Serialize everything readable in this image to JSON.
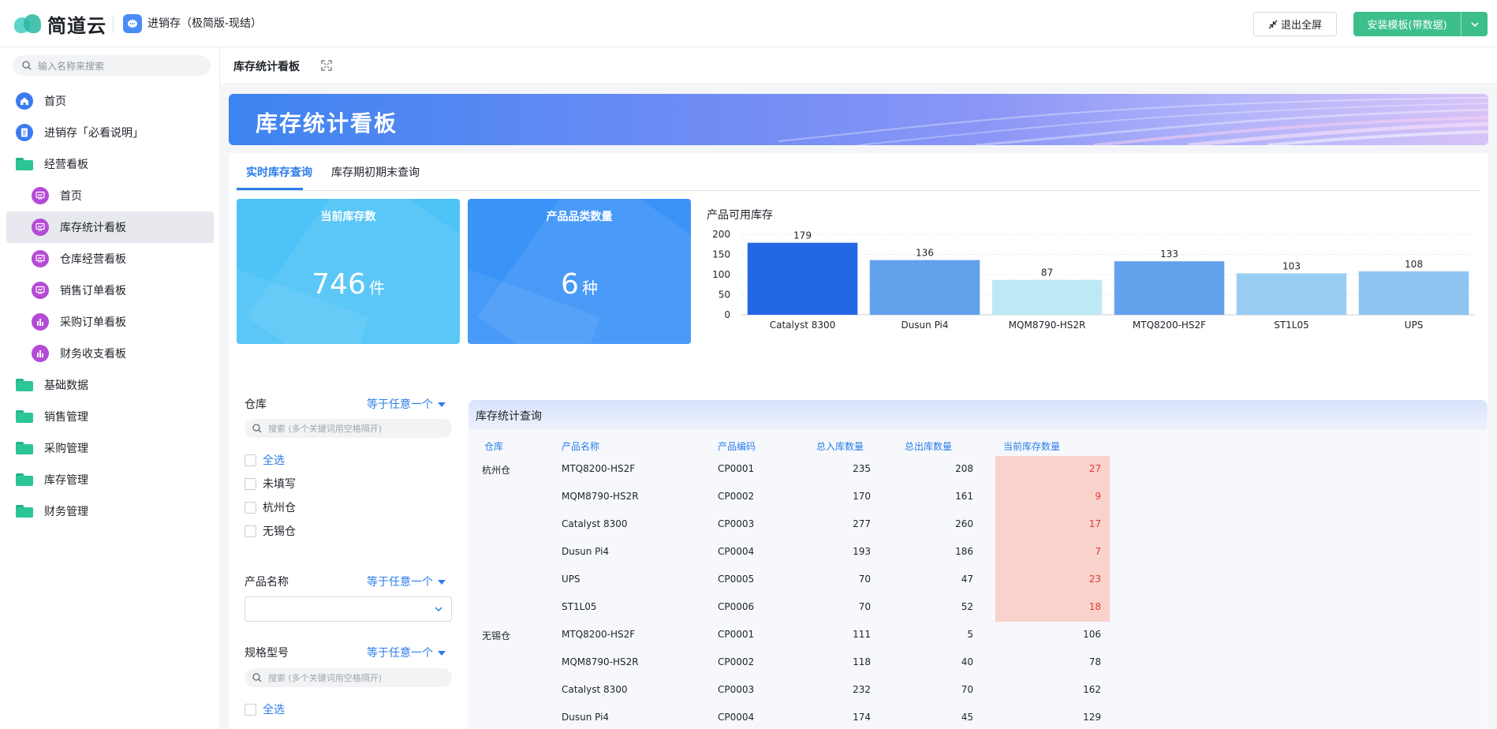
{
  "header": {
    "logo_text": "简道云",
    "app_name": "进销存（极简版-现结）",
    "exit_fullscreen": "退出全屏",
    "install_template": "安装模板(带数据)"
  },
  "sidebar": {
    "search_placeholder": "输入名称来搜索",
    "items": [
      {
        "label": "首页",
        "level": 0,
        "icon": "home-icon"
      },
      {
        "label": "进销存「必看说明」",
        "level": 0,
        "icon": "document-icon"
      },
      {
        "label": "经营看板",
        "level": 0,
        "icon": "folder-open-icon"
      },
      {
        "label": "首页",
        "level": 1,
        "icon": "dashboard-icon"
      },
      {
        "label": "库存统计看板",
        "level": 1,
        "icon": "dashboard-icon",
        "active": true
      },
      {
        "label": "仓库经营看板",
        "level": 1,
        "icon": "dashboard-icon"
      },
      {
        "label": "销售订单看板",
        "level": 1,
        "icon": "dashboard-icon"
      },
      {
        "label": "采购订单看板",
        "level": 1,
        "icon": "bar-chart-icon"
      },
      {
        "label": "财务收支看板",
        "level": 1,
        "icon": "bar-chart-icon"
      },
      {
        "label": "基础数据",
        "level": 0,
        "icon": "folder-icon"
      },
      {
        "label": "销售管理",
        "level": 0,
        "icon": "folder-icon"
      },
      {
        "label": "采购管理",
        "level": 0,
        "icon": "folder-icon"
      },
      {
        "label": "库存管理",
        "level": 0,
        "icon": "folder-icon"
      },
      {
        "label": "财务管理",
        "level": 0,
        "icon": "folder-icon"
      }
    ]
  },
  "page": {
    "title": "库存统计看板",
    "banner_title": "库存统计看板",
    "tabs": [
      "实时库存查询",
      "库存期初期末查询"
    ]
  },
  "cards": [
    {
      "title": "当前库存数",
      "value": "746",
      "unit": "件",
      "color": "#4ec3f7"
    },
    {
      "title": "产品品类数量",
      "value": "6",
      "unit": "种",
      "color": "#3b93f8"
    }
  ],
  "chart_data": {
    "type": "bar",
    "title": "产品可用库存",
    "categories": [
      "Catalyst 8300",
      "Dusun Pi4",
      "MQM8790-HS2R",
      "MTQ8200-HS2F",
      "ST1L05",
      "UPS"
    ],
    "values": [
      179,
      136,
      87,
      133,
      103,
      108
    ],
    "colors": [
      "#2467e4",
      "#62a1ec",
      "#bde9f6",
      "#62a1ec",
      "#99cdf4",
      "#8ec4f2"
    ],
    "ylim": [
      0,
      200
    ],
    "yticks": [
      0,
      50,
      100,
      150,
      200
    ]
  },
  "filters": {
    "warehouse": {
      "label": "仓库",
      "operator": "等于任意一个",
      "search_placeholder": "搜索 (多个关键词用空格隔开)",
      "options": [
        "全选",
        "未填写",
        "杭州仓",
        "无锡仓"
      ]
    },
    "product_name": {
      "label": "产品名称",
      "operator": "等于任意一个"
    },
    "spec": {
      "label": "规格型号",
      "operator": "等于任意一个",
      "search_placeholder": "搜索 (多个关键词用空格隔开)",
      "options": [
        "全选"
      ]
    }
  },
  "table": {
    "title": "库存统计查询",
    "columns": [
      "仓库",
      "产品名称",
      "产品编码",
      "总入库数量",
      "总出库数量",
      "当前库存数量"
    ],
    "highlight_color": "#f9d2cc",
    "rows": [
      {
        "warehouse": "杭州仓",
        "name": "MTQ8200-HS2F",
        "code": "CP0001",
        "in": "235",
        "out": "208",
        "stock": "27",
        "low": true
      },
      {
        "warehouse": "",
        "name": "MQM8790-HS2R",
        "code": "CP0002",
        "in": "170",
        "out": "161",
        "stock": "9",
        "low": true
      },
      {
        "warehouse": "",
        "name": "Catalyst 8300",
        "code": "CP0003",
        "in": "277",
        "out": "260",
        "stock": "17",
        "low": true
      },
      {
        "warehouse": "",
        "name": "Dusun Pi4",
        "code": "CP0004",
        "in": "193",
        "out": "186",
        "stock": "7",
        "low": true
      },
      {
        "warehouse": "",
        "name": "UPS",
        "code": "CP0005",
        "in": "70",
        "out": "47",
        "stock": "23",
        "low": true
      },
      {
        "warehouse": "",
        "name": "ST1L05",
        "code": "CP0006",
        "in": "70",
        "out": "52",
        "stock": "18",
        "low": true
      },
      {
        "warehouse": "无锡仓",
        "name": "MTQ8200-HS2F",
        "code": "CP0001",
        "in": "111",
        "out": "5",
        "stock": "106",
        "low": false
      },
      {
        "warehouse": "",
        "name": "MQM8790-HS2R",
        "code": "CP0002",
        "in": "118",
        "out": "40",
        "stock": "78",
        "low": false
      },
      {
        "warehouse": "",
        "name": "Catalyst 8300",
        "code": "CP0003",
        "in": "232",
        "out": "70",
        "stock": "162",
        "low": false
      },
      {
        "warehouse": "",
        "name": "Dusun Pi4",
        "code": "CP0004",
        "in": "174",
        "out": "45",
        "stock": "129",
        "low": false
      }
    ]
  }
}
